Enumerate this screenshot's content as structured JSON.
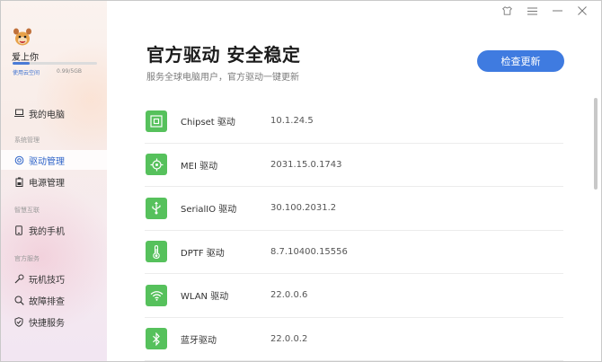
{
  "sidebar": {
    "username": "爱上你",
    "storage_label": "使用云空间",
    "storage_value": "0.99/5GB",
    "storage_fraction": 0.2,
    "items_top": [
      {
        "label": "我的电脑",
        "icon": "laptop-icon"
      }
    ],
    "section_system": "系统管理",
    "system_items": [
      {
        "label": "驱动管理",
        "icon": "driver-icon",
        "active": true
      },
      {
        "label": "电源管理",
        "icon": "battery-icon"
      }
    ],
    "section_smart": "智慧互联",
    "smart_items": [
      {
        "label": "我的手机",
        "icon": "phone-icon"
      }
    ],
    "section_service": "官方服务",
    "service_items": [
      {
        "label": "玩机技巧",
        "icon": "tips-icon"
      },
      {
        "label": "故障排查",
        "icon": "diagnose-icon"
      },
      {
        "label": "快捷服务",
        "icon": "shield-icon"
      }
    ]
  },
  "header": {
    "title": "官方驱动 安全稳定",
    "subtitle": "服务全球电脑用户，官方驱动一键更新",
    "check_button": "检查更新"
  },
  "drivers": [
    {
      "name": "Chipset 驱动",
      "version": "10.1.24.5",
      "icon": "chip-icon"
    },
    {
      "name": "MEI 驱动",
      "version": "2031.15.0.1743",
      "icon": "mei-icon"
    },
    {
      "name": "SerialIO 驱动",
      "version": "30.100.2031.2",
      "icon": "usb-icon"
    },
    {
      "name": "DPTF 驱动",
      "version": "8.7.10400.15556",
      "icon": "thermometer-icon"
    },
    {
      "name": "WLAN 驱动",
      "version": "22.0.0.6",
      "icon": "wifi-icon"
    },
    {
      "name": "蓝牙驱动",
      "version": "22.0.0.2",
      "icon": "bluetooth-icon"
    }
  ],
  "colors": {
    "accent": "#3f7be0",
    "driver_icon_bg": "#56c15c"
  }
}
